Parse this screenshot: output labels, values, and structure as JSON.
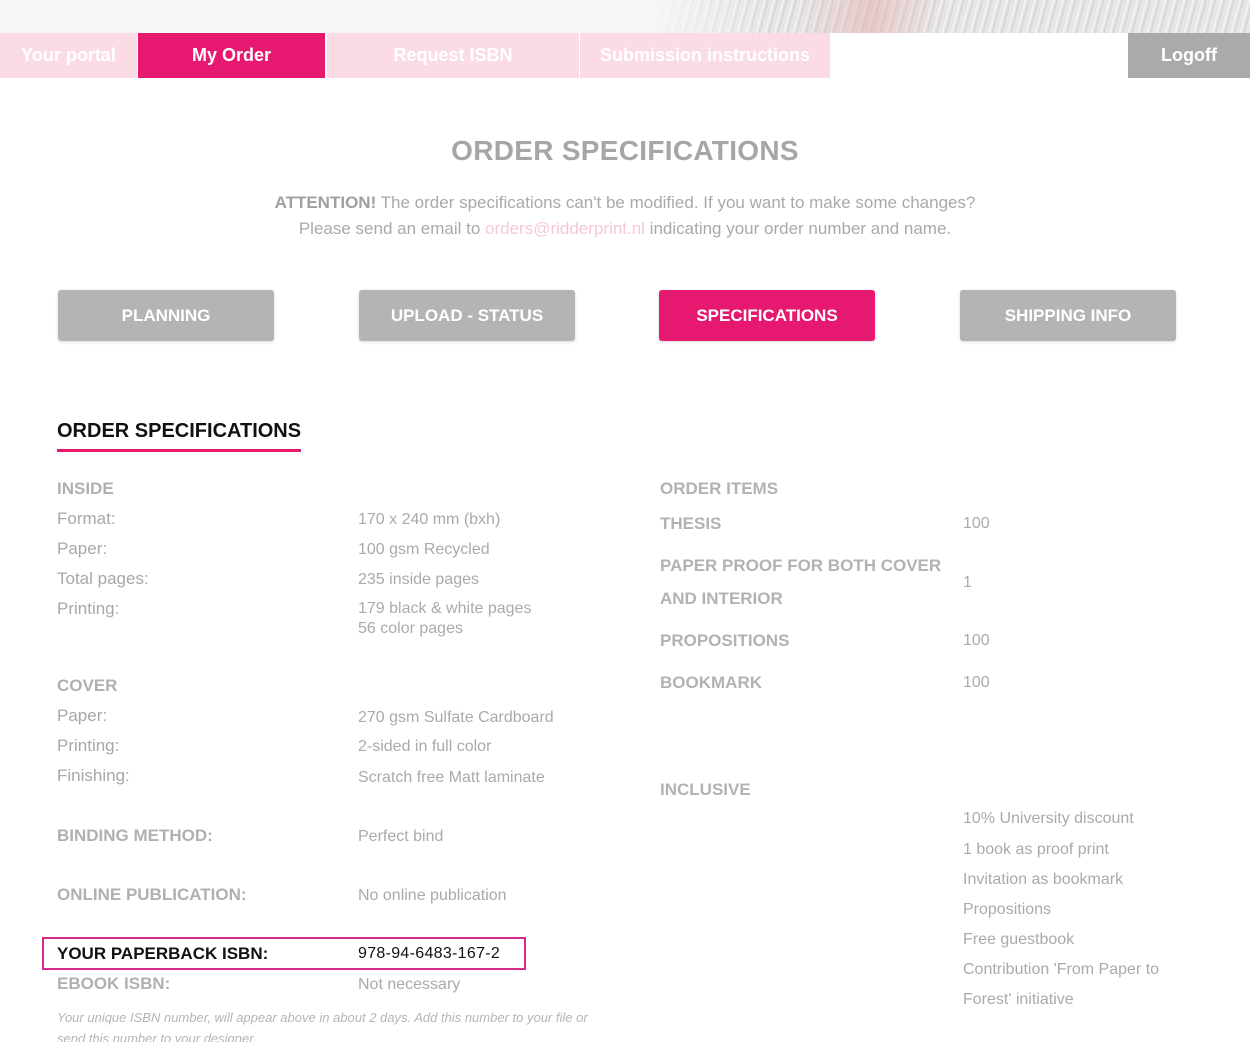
{
  "nav": {
    "tabs": [
      {
        "label": "Your portal"
      },
      {
        "label": "My Order"
      },
      {
        "label": "Request ISBN"
      },
      {
        "label": "Submission instructions"
      }
    ],
    "logoff": "Logoff"
  },
  "title": "ORDER SPECIFICATIONS",
  "notice": {
    "attention": "ATTENTION!",
    "line1": " The order specifications can't be modified. If you want to make some changes?",
    "line2_prefix": "Please send an email to ",
    "email": "orders@ridderprint.nl",
    "line2_suffix": " indicating your order number and name."
  },
  "buttons": {
    "planning": "PLANNING",
    "upload": "UPLOAD - STATUS",
    "specifications": "SPECIFICATIONS",
    "shipping": "SHIPPING INFO"
  },
  "section_heading": "ORDER SPECIFICATIONS",
  "inside": {
    "heading": "INSIDE",
    "format_label": "Format:",
    "format_value": "170 x 240 mm (bxh)",
    "paper_label": "Paper:",
    "paper_value": "100 gsm Recycled",
    "pages_label": "Total pages:",
    "pages_value": "235 inside pages",
    "printing_label": "Printing:",
    "printing_value1": "179 black & white pages",
    "printing_value2": "56 color pages"
  },
  "cover": {
    "heading": "COVER",
    "paper_label": "Paper:",
    "paper_value": "270 gsm Sulfate Cardboard",
    "printing_label": "Printing:",
    "printing_value": "2-sided in full color",
    "finishing_label": "Finishing:",
    "finishing_value": "Scratch free Matt laminate"
  },
  "binding": {
    "label": "BINDING METHOD:",
    "value": "Perfect bind"
  },
  "online": {
    "label": "ONLINE PUBLICATION:",
    "value": "No online publication"
  },
  "isbn": {
    "label": "YOUR PAPERBACK ISBN:",
    "value": "978-94-6483-167-2"
  },
  "ebook": {
    "label": "EBOOK ISBN:",
    "value": "Not necessary"
  },
  "footnote": "Your unique ISBN number, will appear above in about 2 days. Add this number to your file or send this number to your designer.",
  "order_items": {
    "heading": "ORDER ITEMS",
    "items": [
      {
        "label": "THESIS",
        "qty": "100"
      },
      {
        "label1": "PAPER PROOF FOR BOTH COVER",
        "label2": "AND INTERIOR",
        "qty": "1"
      },
      {
        "label": "PROPOSITIONS",
        "qty": "100"
      },
      {
        "label": "BOOKMARK",
        "qty": "100"
      }
    ]
  },
  "inclusive": {
    "heading": "INCLUSIVE",
    "items": [
      "10% University discount",
      "1 book as proof print",
      "Invitation as bookmark",
      "Propositions",
      "Free guestbook",
      "Contribution 'From Paper to",
      "Forest' initiative"
    ]
  },
  "colors": {
    "accent": "#e6186f",
    "tab_inactive": "#fbdce5",
    "button_grey": "#b4b4b4",
    "logoff": "#aaaaaa"
  }
}
